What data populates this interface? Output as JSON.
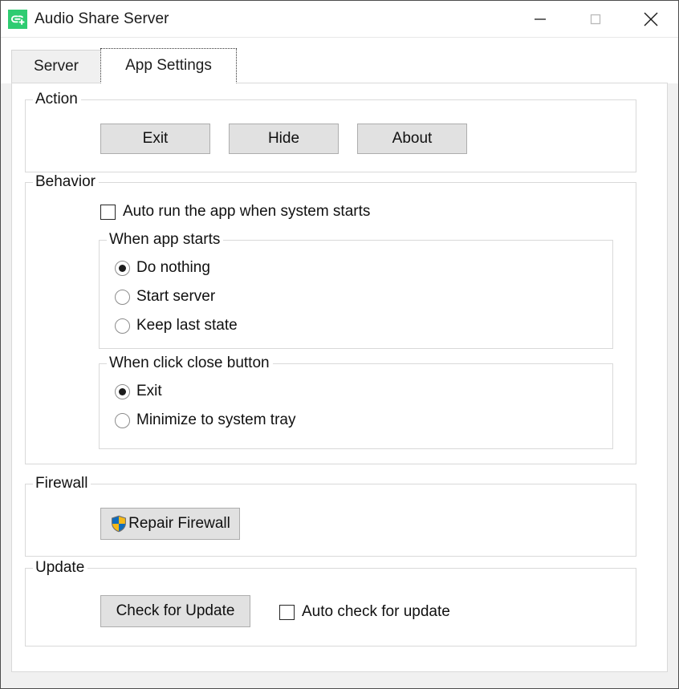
{
  "window": {
    "title": "Audio Share Server",
    "app_icon": "link-plus-icon",
    "icon_color": "#2ecc71",
    "controls": {
      "minimize": "minimize-icon",
      "maximize": "maximize-icon",
      "close": "close-icon"
    }
  },
  "tabs": [
    {
      "label": "Server",
      "active": false
    },
    {
      "label": "App Settings",
      "active": true
    }
  ],
  "groups": {
    "action": {
      "legend": "Action",
      "buttons": [
        {
          "label": "Exit"
        },
        {
          "label": "Hide"
        },
        {
          "label": "About"
        }
      ]
    },
    "behavior": {
      "legend": "Behavior",
      "autorun": {
        "label": "Auto run the app when system starts",
        "checked": false
      },
      "when_app_starts": {
        "legend": "When app starts",
        "options": [
          {
            "label": "Do nothing",
            "selected": true
          },
          {
            "label": "Start server",
            "selected": false
          },
          {
            "label": "Keep last state",
            "selected": false
          }
        ]
      },
      "when_click_close": {
        "legend": "When click close button",
        "options": [
          {
            "label": "Exit",
            "selected": true
          },
          {
            "label": "Minimize to system tray",
            "selected": false
          }
        ]
      }
    },
    "firewall": {
      "legend": "Firewall",
      "repair_button": {
        "label": "Repair Firewall",
        "icon": "uac-shield-icon",
        "icon_colors": {
          "blue": "#0f6cbd",
          "gold": "#f5b917"
        }
      }
    },
    "update": {
      "legend": "Update",
      "check_button": {
        "label": "Check for Update"
      },
      "auto_check": {
        "label": "Auto check for update",
        "checked": false
      }
    }
  }
}
